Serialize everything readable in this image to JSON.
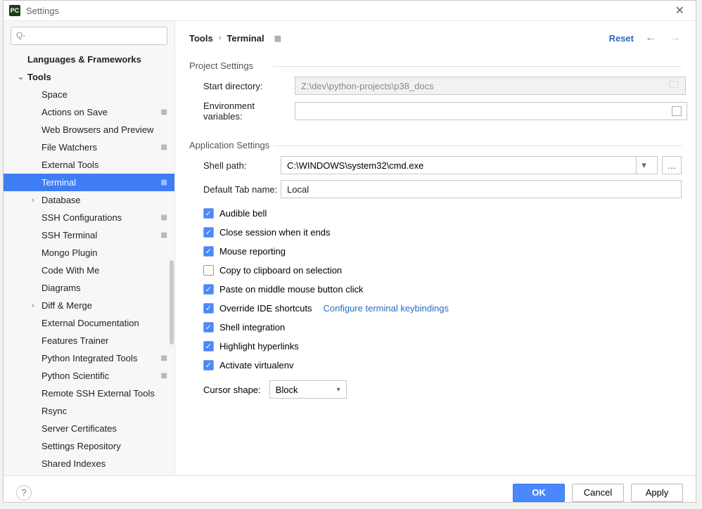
{
  "window": {
    "title": "Settings"
  },
  "search": {
    "placeholder": "",
    "q_prefix": "Q-"
  },
  "sidebar": {
    "top": {
      "label": "Languages & Frameworks"
    },
    "tools_label": "Tools",
    "items": [
      {
        "label": "Space",
        "gear": false
      },
      {
        "label": "Actions on Save",
        "gear": true
      },
      {
        "label": "Web Browsers and Preview",
        "gear": false
      },
      {
        "label": "File Watchers",
        "gear": true
      },
      {
        "label": "External Tools",
        "gear": false
      },
      {
        "label": "Terminal",
        "gear": true,
        "selected": true
      },
      {
        "label": "Database",
        "gear": false,
        "expandable": true
      },
      {
        "label": "SSH Configurations",
        "gear": true
      },
      {
        "label": "SSH Terminal",
        "gear": true
      },
      {
        "label": "Mongo Plugin",
        "gear": false
      },
      {
        "label": "Code With Me",
        "gear": false
      },
      {
        "label": "Diagrams",
        "gear": false
      },
      {
        "label": "Diff & Merge",
        "gear": false,
        "expandable": true
      },
      {
        "label": "External Documentation",
        "gear": false
      },
      {
        "label": "Features Trainer",
        "gear": false
      },
      {
        "label": "Python Integrated Tools",
        "gear": true
      },
      {
        "label": "Python Scientific",
        "gear": true
      },
      {
        "label": "Remote SSH External Tools",
        "gear": false
      },
      {
        "label": "Rsync",
        "gear": false
      },
      {
        "label": "Server Certificates",
        "gear": false
      },
      {
        "label": "Settings Repository",
        "gear": false
      },
      {
        "label": "Shared Indexes",
        "gear": false
      }
    ]
  },
  "breadcrumb": {
    "root": "Tools",
    "leaf": "Terminal"
  },
  "actions": {
    "reset": "Reset"
  },
  "project": {
    "section_title": "Project Settings",
    "start_dir_label": "Start directory:",
    "start_dir_value": "Z:\\dev\\python-projects\\p38_docs",
    "env_label": "Environment variables:",
    "env_value": ""
  },
  "app": {
    "section_title": "Application Settings",
    "shell_label": "Shell path:",
    "shell_value": "C:\\WINDOWS\\system32\\cmd.exe",
    "tab_label": "Default Tab name:",
    "tab_value": "Local",
    "checks": [
      {
        "label": "Audible bell",
        "checked": true
      },
      {
        "label": "Close session when it ends",
        "checked": true
      },
      {
        "label": "Mouse reporting",
        "checked": true
      },
      {
        "label": "Copy to clipboard on selection",
        "checked": false
      },
      {
        "label": "Paste on middle mouse button click",
        "checked": true
      },
      {
        "label": "Override IDE shortcuts",
        "checked": true,
        "link": "Configure terminal keybindings"
      },
      {
        "label": "Shell integration",
        "checked": true
      },
      {
        "label": "Highlight hyperlinks",
        "checked": true
      },
      {
        "label": "Activate virtualenv",
        "checked": true
      }
    ],
    "cursor_label": "Cursor shape:",
    "cursor_value": "Block"
  },
  "footer": {
    "ok": "OK",
    "cancel": "Cancel",
    "apply": "Apply"
  }
}
